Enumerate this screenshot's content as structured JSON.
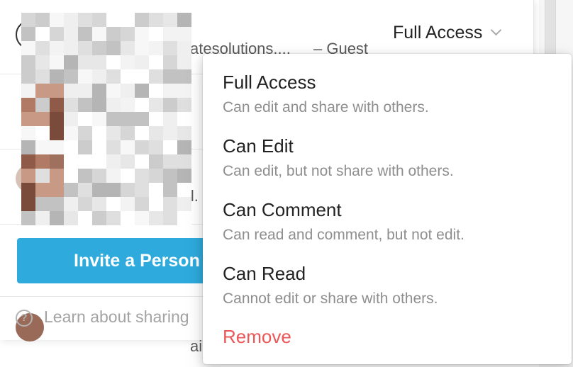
{
  "members": [
    {
      "email_fragment": "atesolutions....",
      "guest_label": "– Guest",
      "access": "Full Access"
    },
    {
      "email_fragment": "il."
    },
    {
      "email_fragment": "ai"
    }
  ],
  "invite": {
    "label": "Invite a Person"
  },
  "help": {
    "label": "Learn about sharing",
    "icon_glyph": "?"
  },
  "menu": {
    "items": [
      {
        "title": "Full Access",
        "description": "Can edit and share with others."
      },
      {
        "title": "Can Edit",
        "description": "Can edit, but not share with others."
      },
      {
        "title": "Can Comment",
        "description": "Can read and comment, but not edit."
      },
      {
        "title": "Can Read",
        "description": "Cannot edit or share with others."
      }
    ],
    "remove_label": "Remove"
  },
  "colors": {
    "accent": "#2eaadc",
    "danger": "#eb5757",
    "text_primary": "#222222",
    "text_secondary": "#8e8e8e"
  },
  "icons": {
    "access_dropdown": "chevron-down-icon",
    "help": "question-circle-icon"
  }
}
